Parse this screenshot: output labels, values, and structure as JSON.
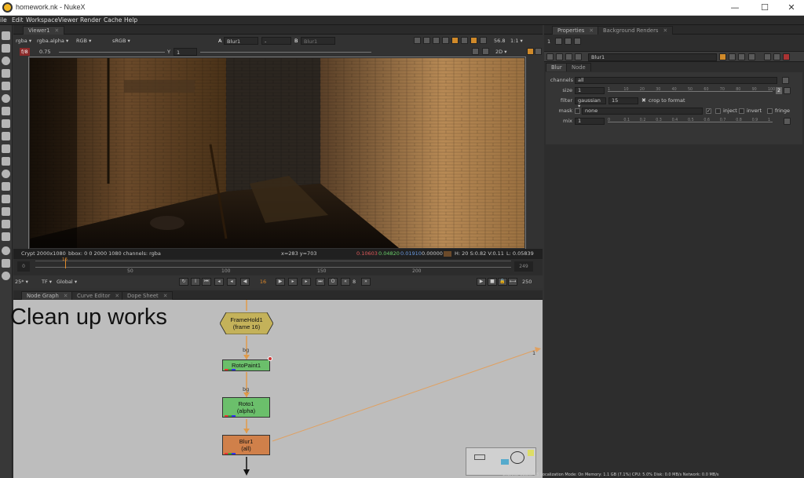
{
  "window": {
    "title": "homework.nk - NukeX",
    "controls": {
      "min": "—",
      "max": "☐",
      "close": "✕"
    }
  },
  "menu": [
    "ile",
    "Edit",
    "Workspace",
    "Viewer",
    "Render",
    "Cache",
    "Help"
  ],
  "viewer": {
    "tab": "Viewer1",
    "channel_set": "rgba",
    "alpha_channel": "rgba.alpha",
    "display_mode": "RGB",
    "colorspace": "sRGB",
    "input_a_label": "A",
    "input_a": "Blur1",
    "composite": "-",
    "input_b_label": "B",
    "input_b": "Blur1",
    "zoom": "56.8",
    "ratio": "1:1",
    "gain_label": "f/8",
    "gain_value": "0.75",
    "gamma_label": "Y",
    "gamma_value": "1",
    "view_mode": "2D",
    "info": {
      "format": "Crypt 2000x1080",
      "bbox": "bbox: 0 0 2000 1080 channels: rgba",
      "coords": "x=283 y=703",
      "r": "0.10603",
      "g": "0.04820",
      "b": "0.01910",
      "a": "0.00000",
      "hsv": "H: 20 S:0.82 V:0.11",
      "l": "L: 0.05839"
    },
    "swatch_color": "#6b4a2a",
    "timeline": {
      "start": "0",
      "end": "249",
      "ticks": [
        "50",
        "100",
        "150",
        "200",
        "249"
      ],
      "marker": "16",
      "bottom_ticks": [
        "0",
        "50",
        "100",
        "150",
        "200",
        "249"
      ]
    },
    "playback": {
      "fps": "25*",
      "tf": "TF",
      "scope": "Global",
      "current_frame": "16",
      "step": "8",
      "end_frame": "250"
    }
  },
  "node_graph": {
    "tabs": [
      "Node Graph",
      "Curve Editor",
      "Dope Sheet"
    ],
    "sticky_note": "Clean up works",
    "nodes": [
      {
        "name": "FrameHold1",
        "sub": "(frame 16)",
        "color": "#c4b25a"
      },
      {
        "name": "RotoPaint1",
        "sub": "",
        "color": "#6bbf6b"
      },
      {
        "name": "Roto1",
        "sub": "(alpha)",
        "color": "#6bbf6b"
      },
      {
        "name": "Blur1",
        "sub": "(all)",
        "color": "#d0804a"
      }
    ],
    "edge_label": "bg",
    "edge_label2": "bg",
    "far_label": "1"
  },
  "properties": {
    "tabs": [
      "Properties",
      "Background Renders"
    ],
    "max_panels": "1",
    "node_name": "Blur1",
    "subtabs": [
      "Blur",
      "Node"
    ],
    "channels_label": "channels",
    "channels_value": "all",
    "size_label": "size",
    "size_value": "1",
    "size_ticks": [
      "1",
      "10",
      "20",
      "30",
      "40",
      "50",
      "60",
      "70",
      "80",
      "90",
      "100"
    ],
    "size_count": "2",
    "filter_label": "filter",
    "filter_value": "gaussian",
    "filter_quality": "15",
    "crop_label": "crop to format",
    "mask_label": "mask",
    "mask_value": "none",
    "inject_label": "inject",
    "invert_label": "invert",
    "fringe_label": "fringe",
    "mix_label": "mix",
    "mix_value": "1",
    "mix_ticks": [
      "0",
      "0.1",
      "0.2",
      "0.3",
      "0.4",
      "0.5",
      "0.6",
      "0.7",
      "0.8",
      "0.9",
      "1"
    ]
  },
  "status": "Channel Count: 15  Localization Mode: On  Memory: 1.1 GB (7.1%)  CPU: 5.0%  Disk: 0.0 MB/s  Network: 0.0 MB/s"
}
